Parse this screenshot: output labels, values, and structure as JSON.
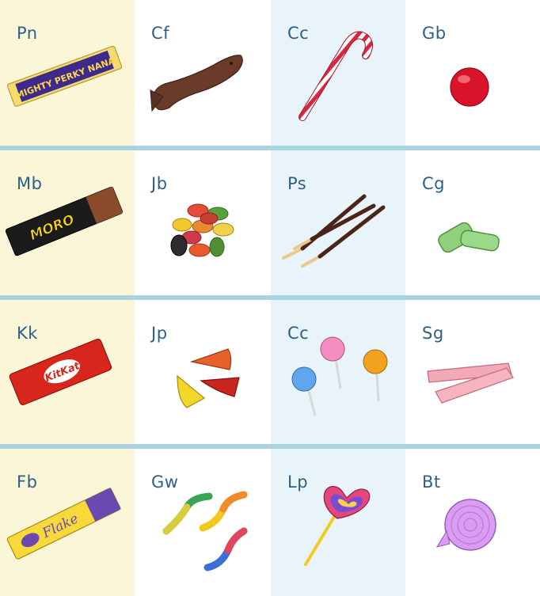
{
  "colors": {
    "col1_bg": "#fcf6d9",
    "col3_bg": "#e9f3fa",
    "divider": "#a9d3de",
    "label": "#2e5f86"
  },
  "rows": [
    {
      "cells": [
        {
          "label": "Pn",
          "icon": "perky-nana-bar-icon",
          "wrapper_text": "MIGHTY PERKY NANA"
        },
        {
          "label": "Cf",
          "icon": "chocolate-fish-icon"
        },
        {
          "label": "Cc",
          "icon": "candy-cane-icon"
        },
        {
          "label": "Gb",
          "icon": "gumball-icon"
        }
      ]
    },
    {
      "cells": [
        {
          "label": "Mb",
          "icon": "moro-bar-icon",
          "wrapper_text": "MORO"
        },
        {
          "label": "Jb",
          "icon": "jelly-beans-icon"
        },
        {
          "label": "Ps",
          "icon": "pocky-sticks-icon"
        },
        {
          "label": "Cg",
          "icon": "chewing-gum-icon"
        }
      ]
    },
    {
      "cells": [
        {
          "label": "Kk",
          "icon": "kitkat-bar-icon",
          "wrapper_text": "KitKat"
        },
        {
          "label": "Jp",
          "icon": "jet-planes-icon"
        },
        {
          "label": "Cc",
          "icon": "lollipops-icon"
        },
        {
          "label": "Sg",
          "icon": "stick-gum-icon"
        }
      ]
    },
    {
      "cells": [
        {
          "label": "Fb",
          "icon": "flake-bar-icon",
          "wrapper_text": "Flake"
        },
        {
          "label": "Gw",
          "icon": "gummy-worms-icon"
        },
        {
          "label": "Lp",
          "icon": "heart-lollipop-icon"
        },
        {
          "label": "Bt",
          "icon": "bubble-tape-icon"
        }
      ]
    }
  ]
}
